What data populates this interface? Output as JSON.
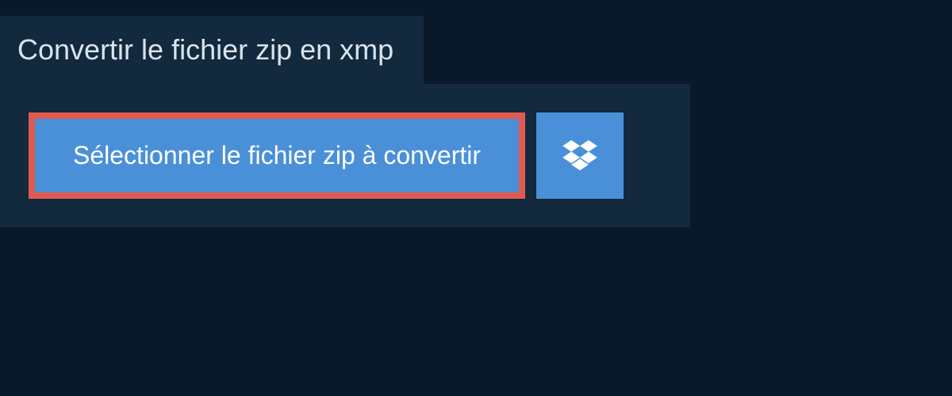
{
  "header": {
    "title": "Convertir le fichier zip en xmp"
  },
  "actions": {
    "select_file_label": "Sélectionner le fichier zip à convertir",
    "dropbox_icon": "dropbox"
  },
  "colors": {
    "background": "#0a1929",
    "panel": "#13293d",
    "button": "#4a90d9",
    "highlight_border": "#e05a4f",
    "text_light": "#d9e4ed",
    "text_white": "#ffffff"
  }
}
